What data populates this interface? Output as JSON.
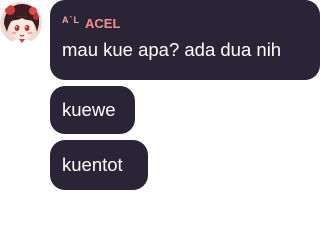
{
  "chat": {
    "sender": {
      "tag": "A`L",
      "name": "ACEL",
      "avatar_icon": "anime-avatar-icon"
    },
    "messages": [
      {
        "text": "mau kue apa? ada dua nih"
      },
      {
        "text": "kuewe"
      },
      {
        "text": "kuentot"
      }
    ]
  },
  "colors": {
    "bubble": "#2a2536",
    "message_text": "#ffffff",
    "sender_name": "#f58d8d",
    "background": "#ffffff"
  }
}
